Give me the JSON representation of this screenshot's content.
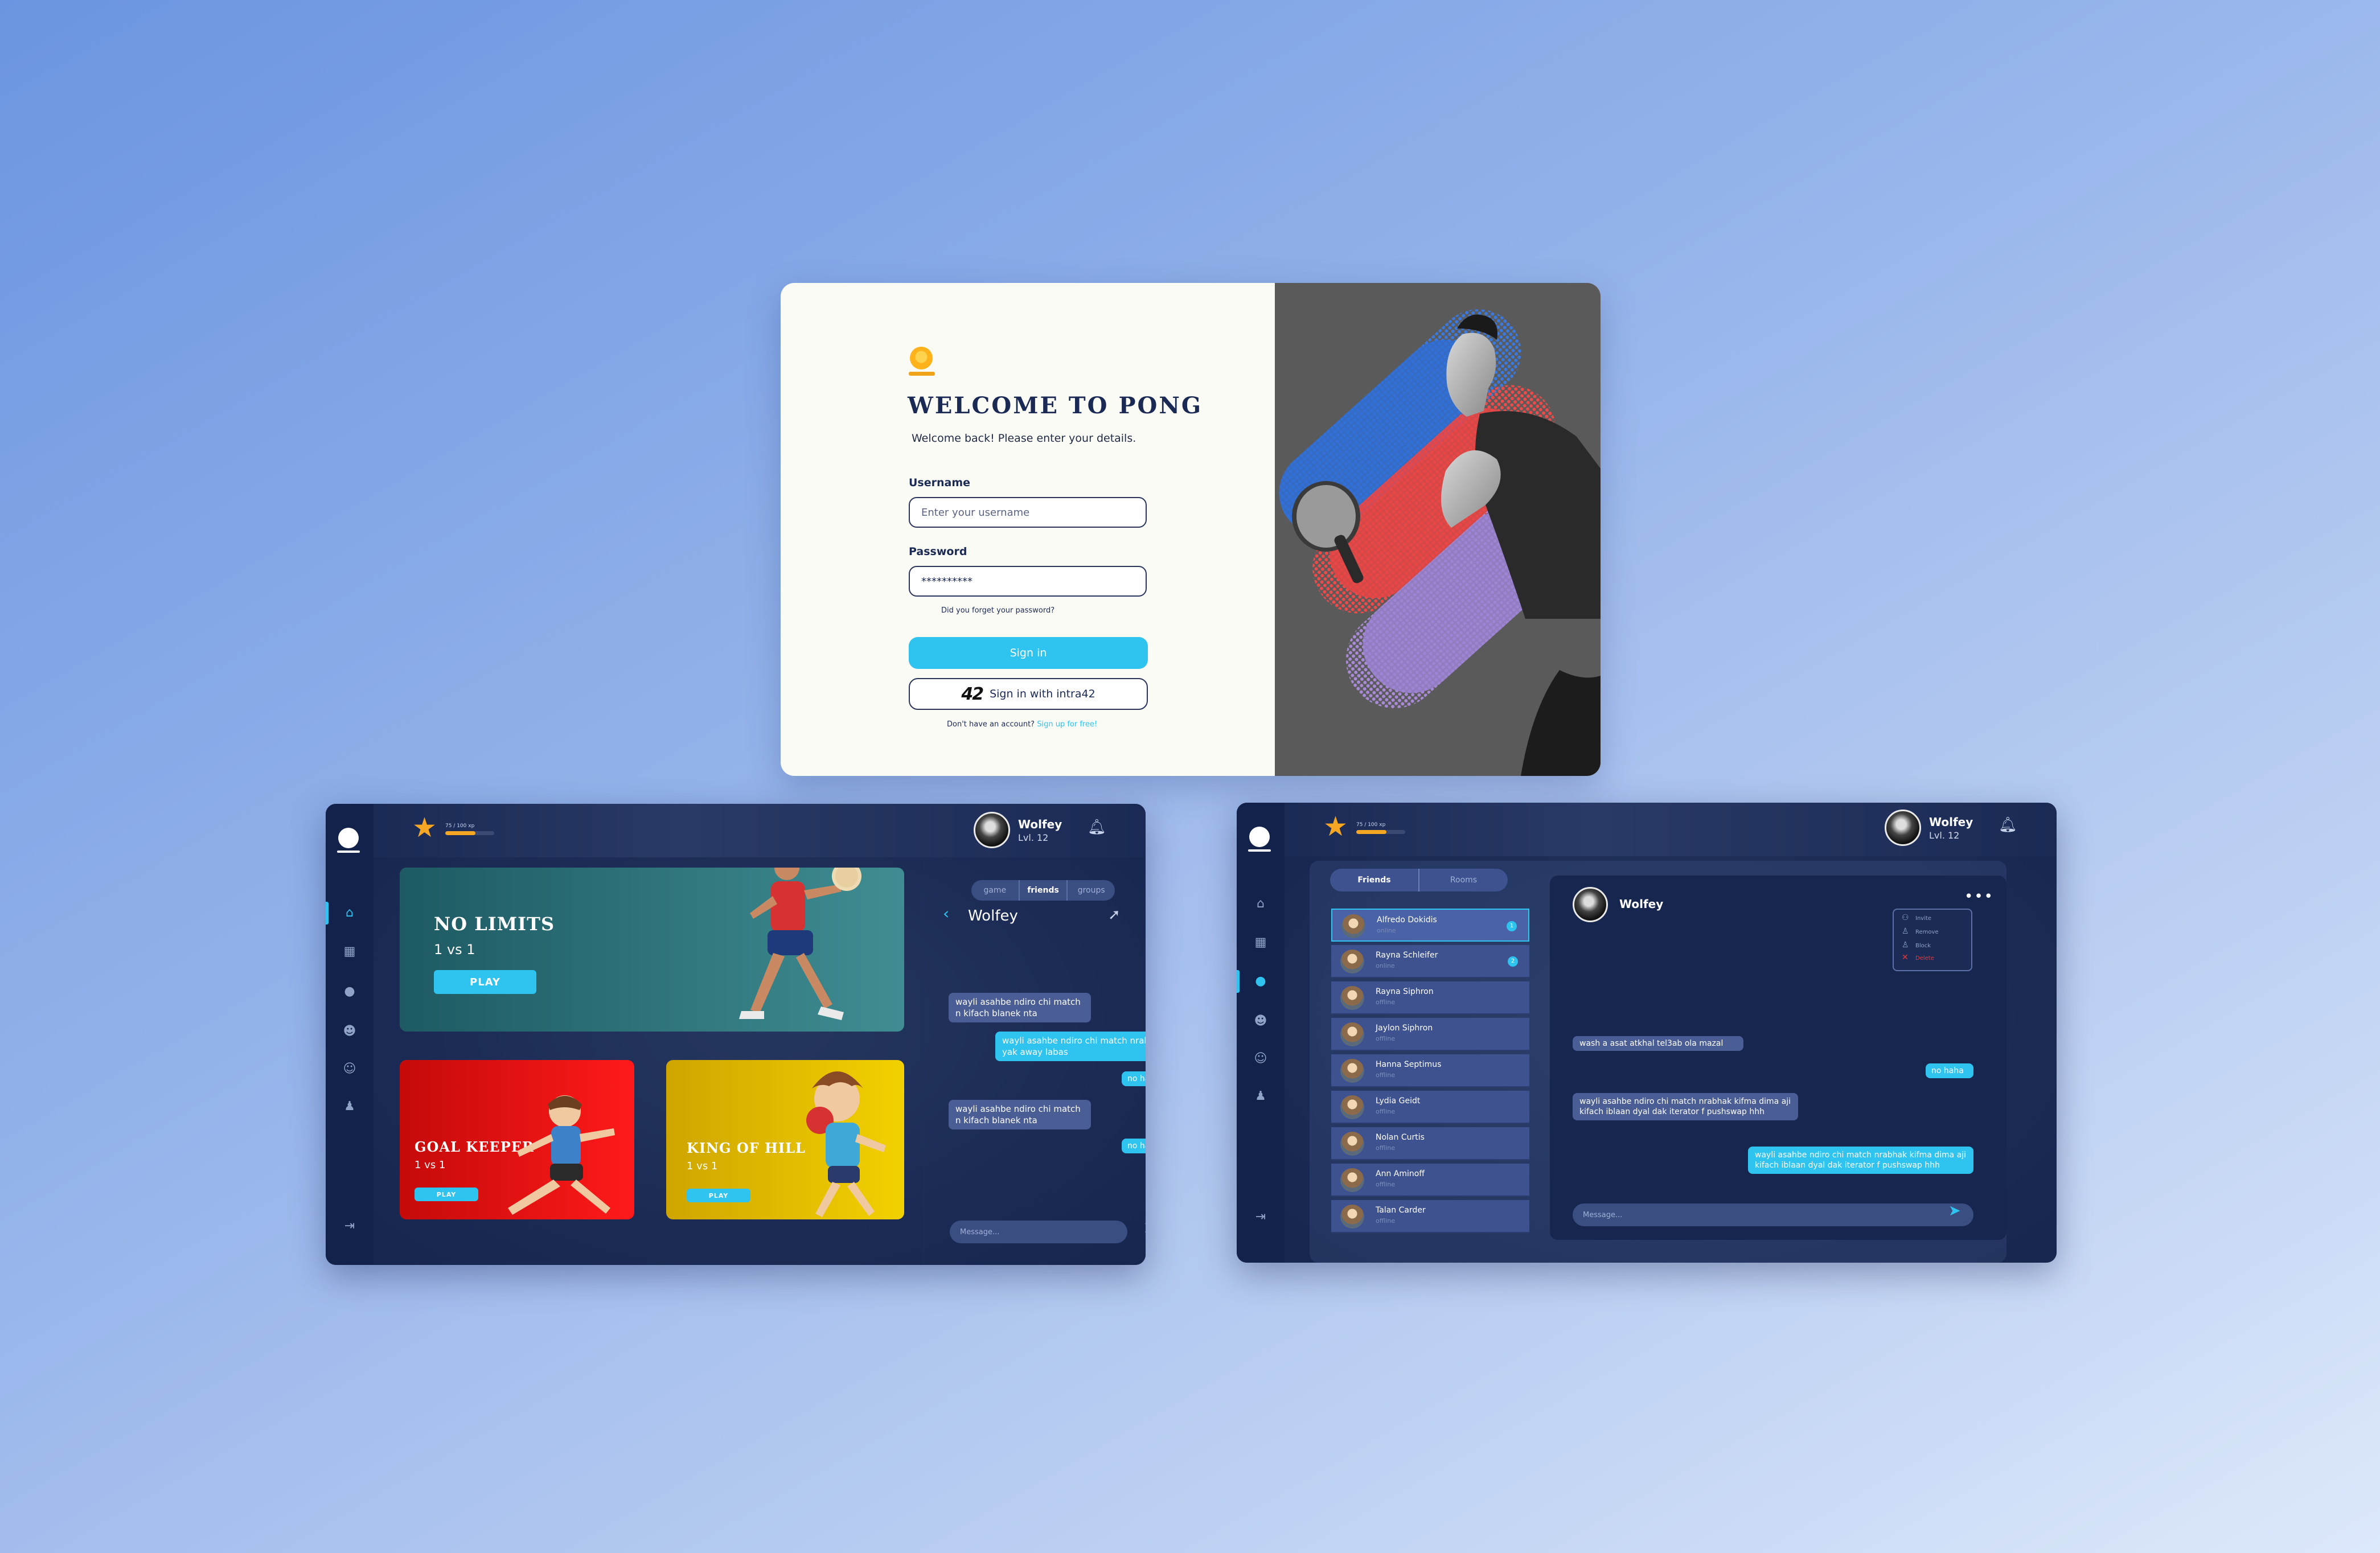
{
  "login": {
    "title": "WELCOME TO PONG",
    "subtitle": "Welcome back! Please enter your details.",
    "username_label": "Username",
    "username_placeholder": "Enter your username",
    "password_label": "Password",
    "password_value": "**********",
    "forgot": "Did you forget your password?",
    "signin_label": "Sign in",
    "intra_logo": "42",
    "intra_label": "Sign in with intra42",
    "signup_prompt": "Don't have an account?",
    "signup_link": "Sign up for free!"
  },
  "dashboard": {
    "user": {
      "name": "Wolfey",
      "level": "Lvl. 12"
    },
    "xp_label": "75 / 100 xp",
    "xp_fraction": 0.62,
    "cards": [
      {
        "title": "NO LIMITS",
        "mode": "1 vs 1",
        "play": "PLAY"
      },
      {
        "title": "GOAL KEEPER",
        "mode": "1 vs 1",
        "play": "PLAY"
      },
      {
        "title": "KING OF HILL",
        "mode": "1 vs 1",
        "play": "PLAY"
      }
    ],
    "chat": {
      "tabs": [
        "game",
        "friends",
        "groups"
      ],
      "active_tab": "friends",
      "contact": "Wolfey",
      "messages": [
        {
          "from": "in",
          "text": "wayli asahbe ndiro chi match n kifach blanek nta"
        },
        {
          "from": "out",
          "text": "wayli asahbe ndiro chi match nrabha yak away labas"
        },
        {
          "from": "out",
          "text": "no haha"
        },
        {
          "from": "in",
          "text": "wayli asahbe ndiro chi match n kifach blanek nta"
        },
        {
          "from": "out",
          "text": "no haha"
        }
      ],
      "input_placeholder": "Message..."
    }
  },
  "chat_page": {
    "user": {
      "name": "Wolfey",
      "level": "Lvl. 12"
    },
    "xp_label": "75 / 100 xp",
    "xp_fraction": 0.62,
    "tabs": [
      "Friends",
      "Rooms"
    ],
    "friends": [
      {
        "name": "Alfredo Dokidis",
        "status": "online",
        "badge": "1"
      },
      {
        "name": "Rayna Schleifer",
        "status": "online",
        "badge": "2"
      },
      {
        "name": "Rayna Siphron",
        "status": "offline",
        "badge": ""
      },
      {
        "name": "Jaylon Siphron",
        "status": "offline",
        "badge": ""
      },
      {
        "name": "Hanna Septimus",
        "status": "offline",
        "badge": ""
      },
      {
        "name": "Lydia Geidt",
        "status": "offline",
        "badge": ""
      },
      {
        "name": "Nolan Curtis",
        "status": "offline",
        "badge": ""
      },
      {
        "name": "Ann Aminoff",
        "status": "offline",
        "badge": ""
      },
      {
        "name": "Talan Carder",
        "status": "offline",
        "badge": ""
      }
    ],
    "conversation": {
      "contact": "Wolfey",
      "menu": [
        "Invite",
        "Remove",
        "Block",
        "Delete"
      ],
      "messages": [
        {
          "from": "in",
          "text": "wash a asat atkhal tel3ab ola mazal"
        },
        {
          "from": "out",
          "text": "no haha"
        },
        {
          "from": "in",
          "text": "wayli asahbe ndiro chi match nrabhak kifma dima aji kifach iblaan dyal dak iterator f pushswap hhh"
        },
        {
          "from": "out",
          "text": "wayli asahbe ndiro chi match nrabhak kifma dima aji kifach iblaan dyal dak iterator f pushswap hhh"
        }
      ],
      "input_placeholder": "Message..."
    }
  },
  "colors": {
    "accent": "#2fc3f0",
    "navy": "#16264e",
    "gold": "#f5a623",
    "red_card": "#e81010",
    "yellow_card": "#e5c300",
    "teal_card": "#2e6f73"
  }
}
